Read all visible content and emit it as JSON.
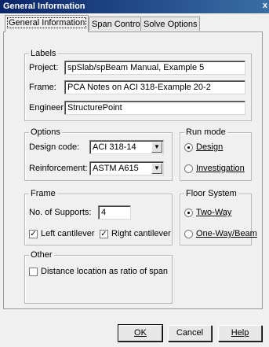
{
  "window": {
    "title": "General Information",
    "close_glyph": "x"
  },
  "tabs": [
    {
      "label": "General Information",
      "active": true
    },
    {
      "label": "Span Control",
      "active": false
    },
    {
      "label": "Solve Options",
      "active": false
    }
  ],
  "labels_group": {
    "legend": "Labels",
    "project_label": "Project:",
    "project_value": "spSlab/spBeam Manual, Example 5",
    "frame_label": "Frame:",
    "frame_value": "PCA Notes on ACI 318-Example 20-2",
    "engineer_label": "Engineer:",
    "engineer_value": "StructurePoint"
  },
  "options_group": {
    "legend": "Options",
    "design_code_label": "Design code:",
    "design_code_value": "ACI 318-14",
    "reinforcement_label": "Reinforcement:",
    "reinforcement_value": "ASTM A615"
  },
  "run_mode_group": {
    "legend": "Run mode",
    "design_label": "Design",
    "design_selected": true,
    "investigation_label": "Investigation",
    "investigation_selected": false
  },
  "frame_group": {
    "legend": "Frame",
    "supports_label": "No. of Supports:",
    "supports_value": "4",
    "left_cantilever_label": "Left cantilever",
    "left_cantilever_checked": true,
    "right_cantilever_label": "Right cantilever",
    "right_cantilever_checked": true
  },
  "floor_system_group": {
    "legend": "Floor System",
    "two_way_label": "Two-Way",
    "two_way_selected": true,
    "one_way_label": "One-Way/Beam",
    "one_way_selected": false
  },
  "other_group": {
    "legend": "Other",
    "distance_label": "Distance location as ratio of span",
    "distance_checked": false
  },
  "buttons": {
    "ok": "OK",
    "cancel": "Cancel",
    "help": "Help"
  },
  "glyphs": {
    "dropdown": "▼",
    "check": "✓"
  }
}
